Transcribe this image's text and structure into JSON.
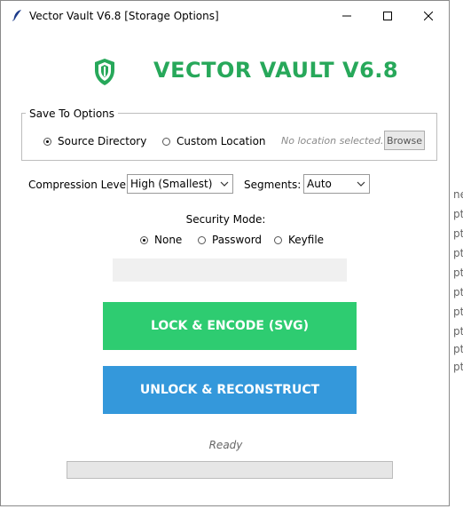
{
  "window": {
    "title": "Vector Vault V6.8 [Storage Options]",
    "controls": [
      "minimize",
      "maximize",
      "close"
    ]
  },
  "header": {
    "title": "VECTOR VAULT V6.8",
    "logo_icon": "shield-icon",
    "accent_color": "#27a85a"
  },
  "save_options": {
    "group_label": "Save To Options",
    "options": [
      {
        "label": "Source Directory",
        "selected": true
      },
      {
        "label": "Custom Location",
        "selected": false
      }
    ],
    "location_placeholder": "No location selected...",
    "browse_label": "Browse"
  },
  "compression": {
    "label": "Compression Level:",
    "value": "High (Smallest)"
  },
  "segments": {
    "label": "Segments:",
    "value": "Auto"
  },
  "security": {
    "label": "Security Mode:",
    "options": [
      {
        "label": "None",
        "selected": true
      },
      {
        "label": "Password",
        "selected": false
      },
      {
        "label": "Keyfile",
        "selected": false
      }
    ]
  },
  "actions": {
    "lock_label": "LOCK & ENCODE (SVG)",
    "lock_color": "#2ecc71",
    "unlock_label": "UNLOCK & RECONSTRUCT",
    "unlock_color": "#3498db"
  },
  "status": {
    "text": "Ready",
    "progress": 0
  },
  "background_window": {
    "fragments": [
      "ne",
      "pt",
      "pt",
      "pt",
      "pt",
      "pt",
      "pt",
      "pt",
      "pt",
      "pt"
    ]
  }
}
